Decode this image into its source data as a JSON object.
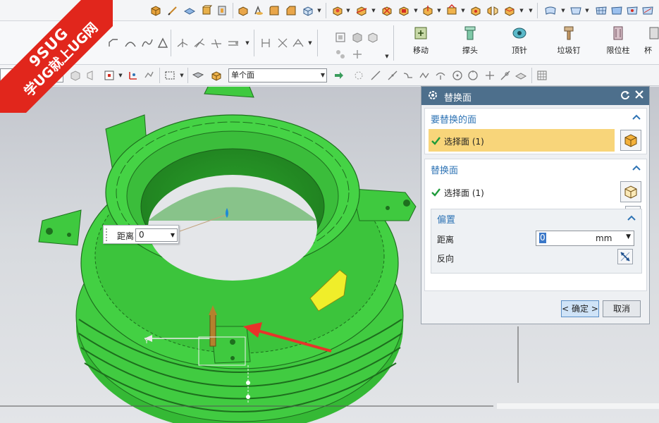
{
  "toolbar_row2": {
    "buttons": [
      {
        "label": "移动",
        "icon": "move-icon"
      },
      {
        "label": "撑头",
        "icon": "support-head-icon"
      },
      {
        "label": "顶针",
        "icon": "ejector-pin-icon"
      },
      {
        "label": "垃圾钉",
        "icon": "stop-pin-icon"
      },
      {
        "label": "限位柱",
        "icon": "limit-post-icon"
      },
      {
        "label": "杯",
        "icon": "cup-icon"
      }
    ]
  },
  "toolbar_row3": {
    "selection_filter": "单个面"
  },
  "distance_tip": {
    "label": "距离",
    "value": "0"
  },
  "dialog": {
    "title": "替换面",
    "face_to_replace": {
      "header": "要替换的面",
      "select_label": "选择面 (1)"
    },
    "replacement_face": {
      "header": "替换面",
      "select_label": "选择面 (1)",
      "reverse_label": "反向"
    },
    "offset": {
      "header": "偏置",
      "distance_label": "距离",
      "distance_value": "0",
      "unit": "mm",
      "reverse_label": "反向"
    },
    "ok_label": "< 确定 >",
    "cancel_label": "取消"
  },
  "watermark": {
    "line1": "9SUG",
    "line2": "学UG就上UG网"
  },
  "colors": {
    "model_green": "#3fcf3f",
    "selected_face": "#f0ee2a",
    "dialog_title": "#4d6f8c",
    "group_header": "#2f74b5",
    "highlight_row": "#f8d57a",
    "watermark_red": "#e1261c",
    "arrow_red": "#e8332a"
  }
}
